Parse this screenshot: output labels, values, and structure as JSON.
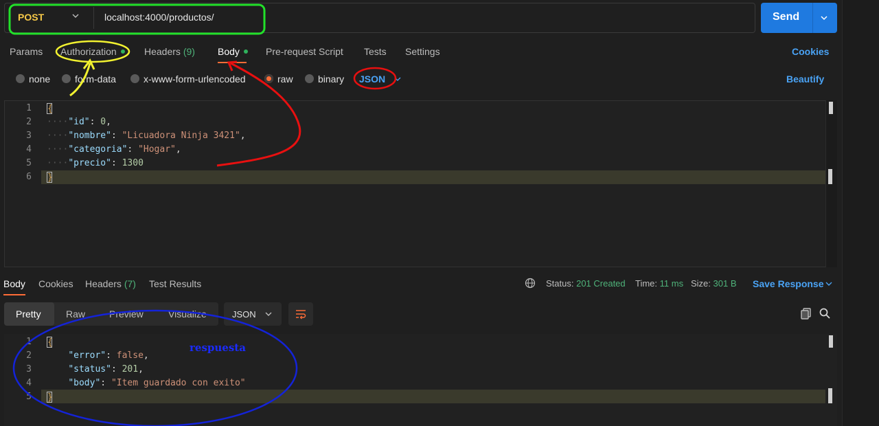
{
  "request": {
    "method": "POST",
    "url": "localhost:4000/productos/",
    "send_label": "Send"
  },
  "request_tabs": [
    {
      "label": "Params"
    },
    {
      "label": "Authorization"
    },
    {
      "label": "Headers",
      "count": "(9)"
    },
    {
      "label": "Body"
    },
    {
      "label": "Pre-request Script"
    },
    {
      "label": "Tests"
    },
    {
      "label": "Settings"
    }
  ],
  "cookies_label": "Cookies",
  "body_types": [
    "none",
    "form-data",
    "x-www-form-urlencoded",
    "raw",
    "binary"
  ],
  "body_type_selected": "raw",
  "body_format": "JSON",
  "beautify_label": "Beautify",
  "request_body_lines": [
    {
      "n": "1",
      "text": "{"
    },
    {
      "n": "2",
      "key": "\"id\"",
      "value": "0",
      "value_type": "number",
      "comma": ","
    },
    {
      "n": "3",
      "key": "\"nombre\"",
      "value": "\"Licuadora Ninja 3421\"",
      "value_type": "string",
      "comma": ","
    },
    {
      "n": "4",
      "key": "\"categoria\"",
      "value": "\"Hogar\"",
      "value_type": "string",
      "comma": ","
    },
    {
      "n": "5",
      "key": "\"precio\"",
      "value": "1300",
      "value_type": "number",
      "comma": ""
    },
    {
      "n": "6",
      "text": "}"
    }
  ],
  "response_tabs": [
    {
      "label": "Body"
    },
    {
      "label": "Cookies"
    },
    {
      "label": "Headers",
      "count": "(7)"
    },
    {
      "label": "Test Results"
    }
  ],
  "response_status": {
    "status_label": "Status:",
    "status_value": "201 Created",
    "time_label": "Time:",
    "time_value": "11 ms",
    "size_label": "Size:",
    "size_value": "301 B"
  },
  "save_response_label": "Save Response",
  "response_views": [
    "Pretty",
    "Raw",
    "Preview",
    "Visualize"
  ],
  "response_format": "JSON",
  "response_body_lines": [
    {
      "n": "1",
      "text": "{"
    },
    {
      "n": "2",
      "key": "\"error\"",
      "value": "false",
      "value_type": "bool",
      "comma": ","
    },
    {
      "n": "3",
      "key": "\"status\"",
      "value": "201",
      "value_type": "number",
      "comma": ","
    },
    {
      "n": "4",
      "key": "\"body\"",
      "value": "\"Item guardado con exito\"",
      "value_type": "string",
      "comma": ""
    },
    {
      "n": "5",
      "text": "}"
    }
  ],
  "annotation_text": "respuesta",
  "colors": {
    "accent": "#ff6c37",
    "link": "#4aa3f5",
    "send": "#1f7ae0",
    "ok": "#4fb37a",
    "method": "#f7c948"
  }
}
